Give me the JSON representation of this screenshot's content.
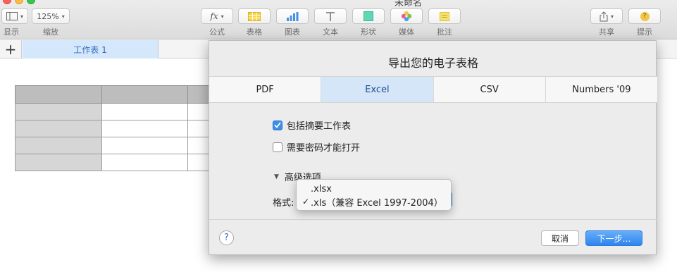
{
  "window": {
    "title": "未命名"
  },
  "toolbar": {
    "view_label": "显示",
    "zoom_value": "125%",
    "zoom_label": "缩放",
    "formula_glyph": "fx",
    "items": [
      {
        "label": "公式"
      },
      {
        "label": "表格"
      },
      {
        "label": "图表"
      },
      {
        "label": "文本"
      },
      {
        "label": "形状"
      },
      {
        "label": "媒体"
      },
      {
        "label": "批注"
      }
    ],
    "share_label": "共享",
    "tips_label": "提示",
    "tips_glyph": "?"
  },
  "sheet_tabs": {
    "add_glyph": "+",
    "active": "工作表 1"
  },
  "dialog": {
    "title": "导出您的电子表格",
    "tabs": [
      {
        "label": "PDF",
        "active": false
      },
      {
        "label": "Excel",
        "active": true
      },
      {
        "label": "CSV",
        "active": false
      },
      {
        "label": "Numbers '09",
        "active": false
      }
    ],
    "options": {
      "include_summary": {
        "label": "包括摘要工作表",
        "checked": true
      },
      "require_password": {
        "label": "需要密码才能打开",
        "checked": false
      }
    },
    "advanced": {
      "label": "高级选项",
      "expanded": true
    },
    "format": {
      "label": "格式:",
      "options": [
        {
          "label": ".xlsx",
          "selected": false
        },
        {
          "label": ".xls（兼容 Excel 1997-2004）",
          "selected": true
        }
      ],
      "check_glyph": "✓"
    },
    "help_glyph": "?",
    "cancel_label": "取消",
    "next_label": "下一步…"
  },
  "colors": {
    "accent": "#3b8eea",
    "active_tab_bg": "#d5e6f8",
    "sheet_tab_text": "#2f6cc4"
  }
}
